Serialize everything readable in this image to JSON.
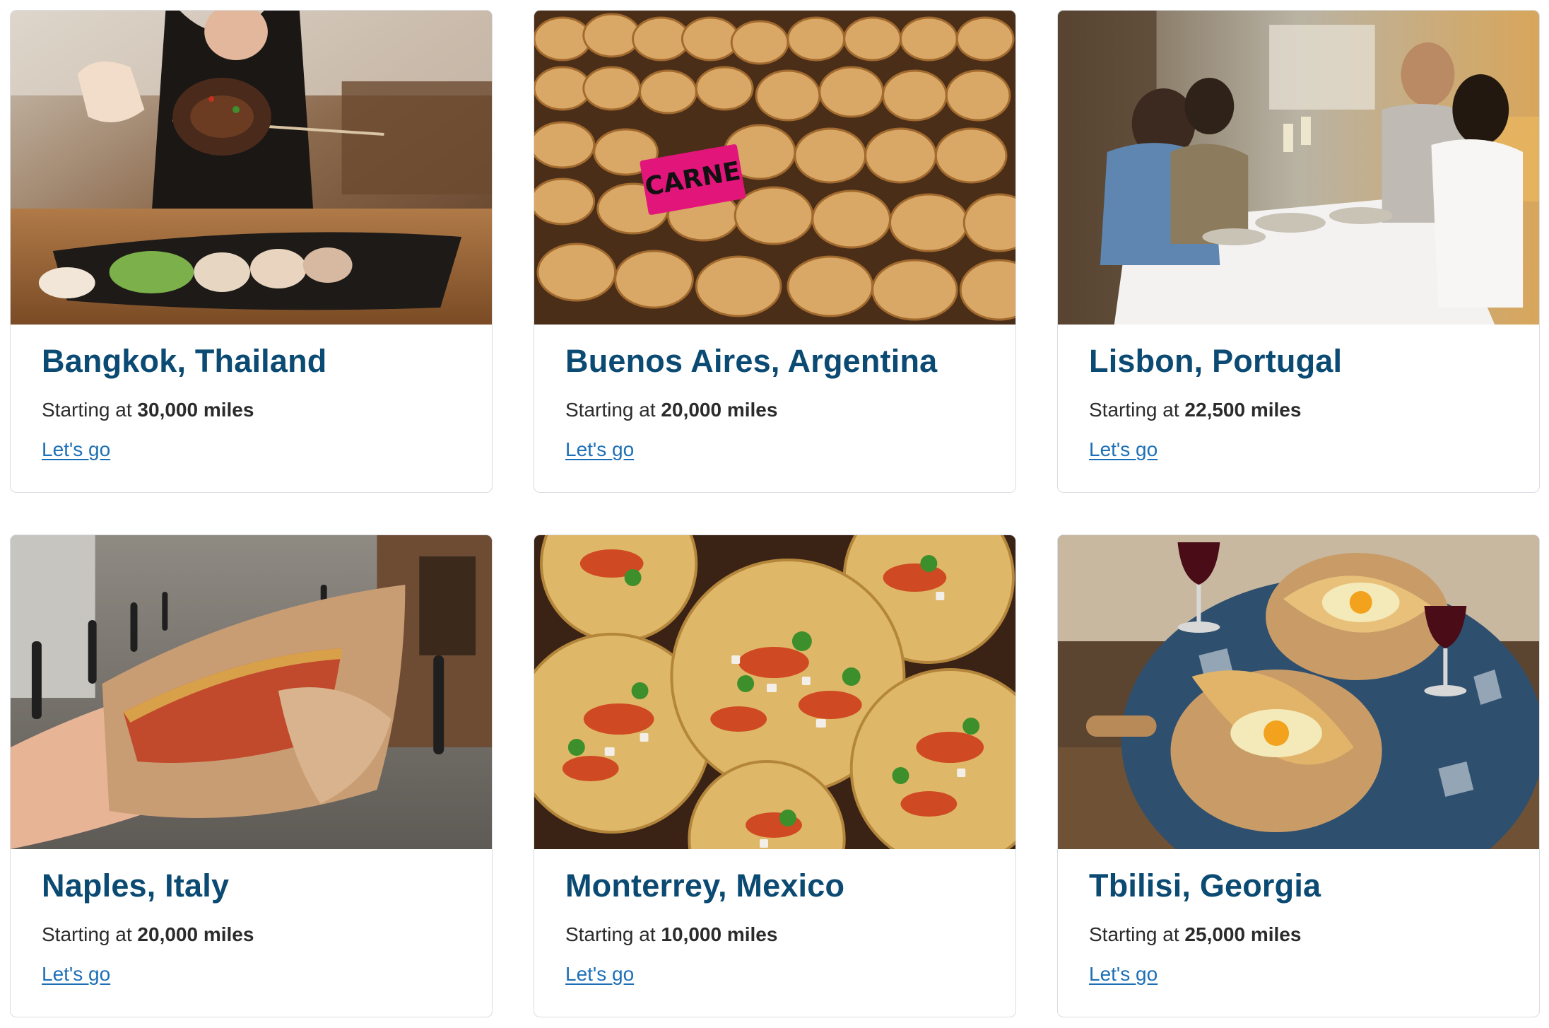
{
  "cards": [
    {
      "title": "Bangkok, Thailand",
      "price_prefix": "Starting at",
      "price_value": "30,000 miles",
      "cta": "Let's go",
      "photo": "bangkok-food-photo"
    },
    {
      "title": "Buenos Aires, Argentina",
      "price_prefix": "Starting at",
      "price_value": "20,000 miles",
      "cta": "Let's go",
      "photo": "buenos-aires-empanadas-photo",
      "photo_sign": "CARNE"
    },
    {
      "title": "Lisbon, Portugal",
      "price_prefix": "Starting at",
      "price_value": "22,500 miles",
      "cta": "Let's go",
      "photo": "lisbon-dinner-photo"
    },
    {
      "title": "Naples, Italy",
      "price_prefix": "Starting at",
      "price_value": "20,000 miles",
      "cta": "Let's go",
      "photo": "naples-street-pizza-photo"
    },
    {
      "title": "Monterrey, Mexico",
      "price_prefix": "Starting at",
      "price_value": "10,000 miles",
      "cta": "Let's go",
      "photo": "monterrey-tacos-photo"
    },
    {
      "title": "Tbilisi, Georgia",
      "price_prefix": "Starting at",
      "price_value": "25,000 miles",
      "cta": "Let's go",
      "photo": "tbilisi-khachapuri-photo"
    }
  ],
  "colors": {
    "title": "#0b4a72",
    "link": "#1c6fb6",
    "card_border": "#d9dde2"
  }
}
